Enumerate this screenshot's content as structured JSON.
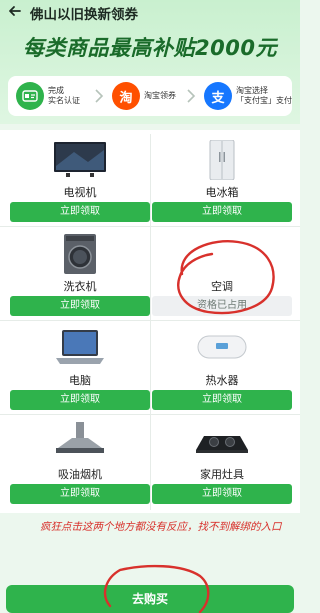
{
  "topbar": {
    "title": "佛山以旧换新领券"
  },
  "banner": {
    "slogan": "每类商品最高补贴2000元"
  },
  "steps": [
    {
      "label_1": "完成",
      "label_2": "实名认证"
    },
    {
      "label_1": "淘宝领券",
      "label_2": ""
    },
    {
      "label_1": "淘宝选择",
      "label_2": "「支付宝」支付"
    }
  ],
  "products": [
    {
      "name": "电视机",
      "button": "立即领取"
    },
    {
      "name": "电冰箱",
      "button": "立即领取"
    },
    {
      "name": "洗衣机",
      "button": "立即领取"
    },
    {
      "name": "空调",
      "button": "资格已占用"
    },
    {
      "name": "电脑",
      "button": "立即领取"
    },
    {
      "name": "热水器",
      "button": "立即领取"
    },
    {
      "name": "吸油烟机",
      "button": "立即领取"
    },
    {
      "name": "家用灶具",
      "button": "立即领取"
    }
  ],
  "annotation": {
    "note": "疯狂点击这两个地方都没有反应，找不到解绑的入口"
  },
  "footer": {
    "buy_label": "去购买"
  },
  "colors": {
    "brand_green": "#2fb34c",
    "annotation_red": "#d8312c",
    "taobao_orange": "#ff5000",
    "alipay_blue": "#1677ff"
  }
}
